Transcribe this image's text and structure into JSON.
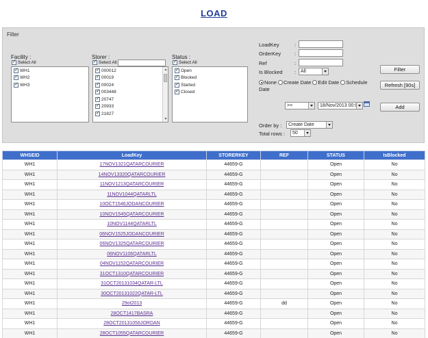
{
  "title": "LOAD",
  "filter": {
    "legend": "Filter",
    "facility": {
      "label": "Facility :",
      "select_all": "Select All",
      "items": [
        "WH1",
        "WH2",
        "WH3"
      ]
    },
    "storer": {
      "label": "Storer :",
      "select_all": "Select All",
      "items": [
        "000012",
        "00019",
        "00024",
        "003448",
        "20747",
        "20933",
        "21827"
      ]
    },
    "status": {
      "label": "Status :",
      "select_all": "Select All",
      "items": [
        "Open",
        "Blocked",
        "Started",
        "Closed"
      ]
    },
    "loadkey_label": "LoadKey",
    "orderkey_label": "OrderKey",
    "ref_label": "Ref",
    "isblocked_label": "Is Blocked",
    "isblocked_value": "All",
    "colon": ":",
    "date_options": [
      "None",
      "Create Date",
      "Edit Date",
      "Schedule Date"
    ],
    "operator_value": ">=",
    "date_value": "18/Nov/2013 00:00",
    "orderby_label": "Order by :",
    "orderby_value": "Create Date",
    "totalrows_label": "Total rows :",
    "totalrows_value": "50",
    "filter_button": "Filter",
    "refresh_button": "Refresh [90s]",
    "add_button": "Add"
  },
  "table": {
    "columns": [
      "WHSEID",
      "LoadKey",
      "STORERKEY",
      "REF",
      "STATUS",
      "IsBlocked"
    ],
    "rows": [
      [
        "WH1",
        "17NOV1321QATARCOURIER",
        "44659-G",
        "",
        "Open",
        "No"
      ],
      [
        "WH1",
        "14NOV13320QATARCOURIER",
        "44659-G",
        "",
        "Open",
        "No"
      ],
      [
        "WH1",
        "11NOV1213QATARCOURIER",
        "44659-G",
        "",
        "Open",
        "No"
      ],
      [
        "WH1",
        "11NOV1044QATARLTL",
        "44659-G",
        "",
        "Open",
        "No"
      ],
      [
        "WH1",
        "10OCT1546JODANCOURIER",
        "44659-G",
        "",
        "Open",
        "No"
      ],
      [
        "WH1",
        "10NOV1545QATARCOURIER",
        "44659-G",
        "",
        "Open",
        "No"
      ],
      [
        "WH1",
        "10NOV1144QATARLTL",
        "44659-G",
        "",
        "Open",
        "No"
      ],
      [
        "WH1",
        "06NOV1525JODANCOURIER",
        "44659-G",
        "",
        "Open",
        "No"
      ],
      [
        "WH1",
        "06NOV1325QATARCOURIER",
        "44659-G",
        "",
        "Open",
        "No"
      ],
      [
        "WH1",
        "06NOV1106QATARLTL",
        "44659-G",
        "",
        "Open",
        "No"
      ],
      [
        "WH1",
        "04NOV1152QATARCOURIER",
        "44659-G",
        "",
        "Open",
        "No"
      ],
      [
        "WH1",
        "31OCT1310QATARCOURIER",
        "44659-G",
        "",
        "Open",
        "No"
      ],
      [
        "WH1",
        "31OCT20131034QATAR-LTL",
        "44659-G",
        "",
        "Open",
        "No"
      ],
      [
        "WH1",
        "30OCT20131022QATAR-LTL",
        "44659-G",
        "",
        "Open",
        "No"
      ],
      [
        "WH1",
        "29ot2013",
        "44659-G",
        "dd",
        "Open",
        "No"
      ],
      [
        "WH1",
        "28OCT1417BASRA",
        "44659-G",
        "",
        "Open",
        "No"
      ],
      [
        "WH1",
        "28OCT20131056JORDAN",
        "44659-G",
        "",
        "Open",
        "No"
      ],
      [
        "WH1",
        "28OCT1055QATARCOURIER",
        "44659-G",
        "",
        "Open",
        "No"
      ]
    ]
  }
}
